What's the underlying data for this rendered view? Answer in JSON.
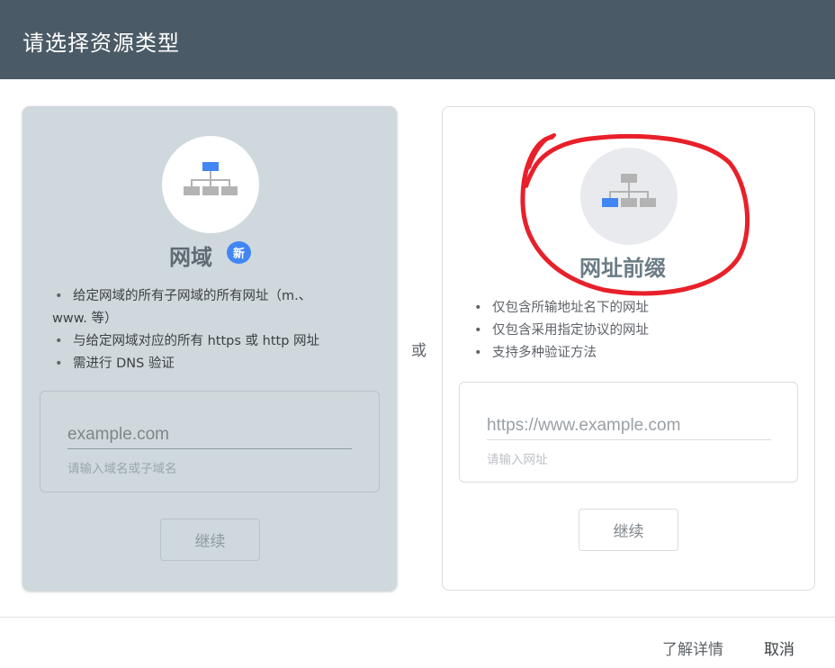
{
  "dialog": {
    "title": "请选择资源类型"
  },
  "domain_card": {
    "title": "网域",
    "badge": "新",
    "bullets": [
      "给定网域的所有子网域的所有网址（m.、",
      "www. 等）",
      "与给定网域对应的所有 https 或 http 网址",
      "需进行 DNS 验证"
    ],
    "input": {
      "placeholder": "example.com",
      "value": ""
    },
    "hint": "请输入域名或子域名",
    "continue_label": "继续",
    "icon": "sitemap-icon",
    "colors": {
      "background": "#cfd8dc",
      "icon_accent": "#4285f4"
    }
  },
  "separator": {
    "label": "或"
  },
  "url_prefix_card": {
    "title": "网址前缀",
    "bullets": [
      "仅包含所输地址名下的网址",
      "仅包含采用指定协议的网址",
      "支持多种验证方法"
    ],
    "input": {
      "placeholder": "https://www.example.com",
      "value": ""
    },
    "hint": "请输入网址",
    "continue_label": "继续",
    "icon": "sitemap-icon",
    "colors": {
      "background": "#ffffff",
      "icon_accent": "#4285f4"
    }
  },
  "footer": {
    "learn_more_label": "了解详情",
    "cancel_label": "取消"
  },
  "colors": {
    "titlebar": "#4a5a66",
    "annotation": "#e8202a"
  }
}
